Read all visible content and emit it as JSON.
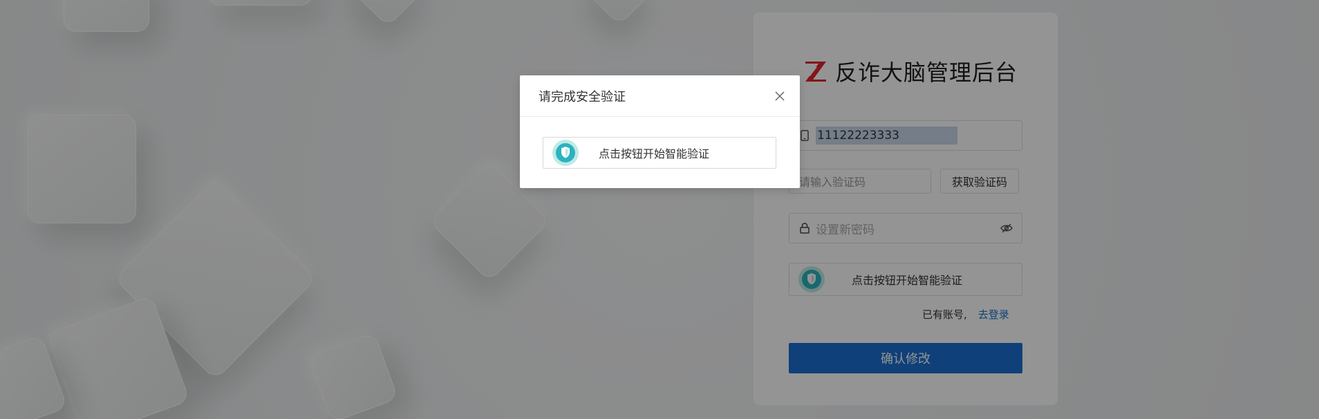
{
  "brand": {
    "title": "反诈大脑管理后台",
    "logo_icon": "z-logo-icon",
    "logo_color": "#e0262e"
  },
  "form": {
    "phone": {
      "icon": "phone-icon",
      "value": "11122223333"
    },
    "code": {
      "placeholder": "请输入验证码",
      "button_label": "获取验证码"
    },
    "password": {
      "icon": "lock-icon",
      "placeholder": "设置新密码",
      "toggle_icon": "eye-hidden-icon"
    },
    "verify": {
      "icon": "shield-icon",
      "label": "点击按钮开始智能验证"
    },
    "account": {
      "prompt": "已有账号,",
      "login_link": "去登录"
    },
    "submit_label": "确认修改"
  },
  "modal": {
    "title": "请完成安全验证",
    "close_icon": "close-icon",
    "verify": {
      "icon": "shield-icon",
      "label": "点击按钮开始智能验证"
    }
  },
  "colors": {
    "accent": "#1a6fd0",
    "link": "#1a73c8",
    "shield": "#2bb3c0"
  }
}
